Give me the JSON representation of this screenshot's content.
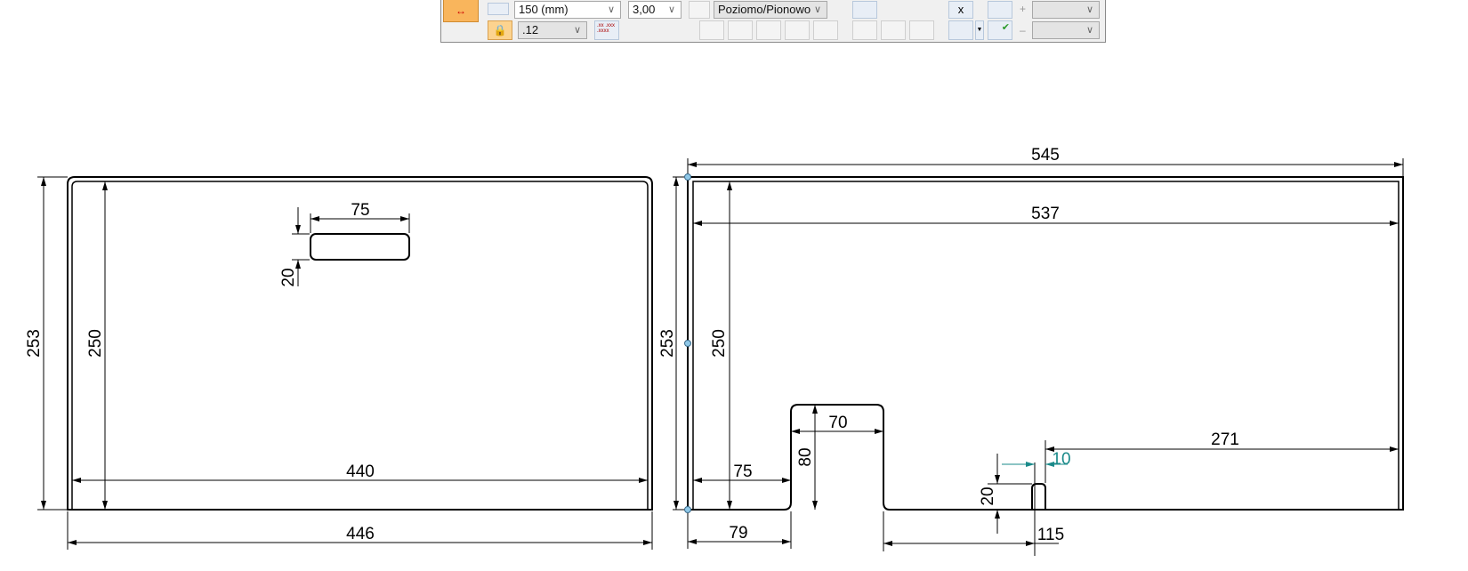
{
  "toolbar": {
    "scale_value": "150 (mm)",
    "size_value": "3,00",
    "orientation_value": "Poziomo/Pionowo",
    "precision_value": ".12",
    "precision_icon_text": ".xx .xxx .xxxx",
    "plus_label": "+",
    "minus_label": "–",
    "x_label": "x",
    "accent_color": "#f9b55c"
  },
  "drawing": {
    "left_view": {
      "overall_height": "253",
      "inner_height": "250",
      "inner_width": "440",
      "overall_width": "446",
      "slot_width": "75",
      "slot_height": "20"
    },
    "right_view": {
      "overall_width": "545",
      "inner_width": "537",
      "overall_height": "253",
      "inner_height": "250",
      "notch_width": "70",
      "notch_height": "80",
      "notch_offset_inner": "75",
      "notch_offset_outer": "79",
      "tab_height": "20",
      "tab_offset": "115",
      "tab_to_right": "271",
      "tab_width_edit": "10"
    },
    "colors": {
      "line": "#000000",
      "edit_dimension": "#1a8a8a",
      "handle": "#8fc8e8"
    }
  }
}
